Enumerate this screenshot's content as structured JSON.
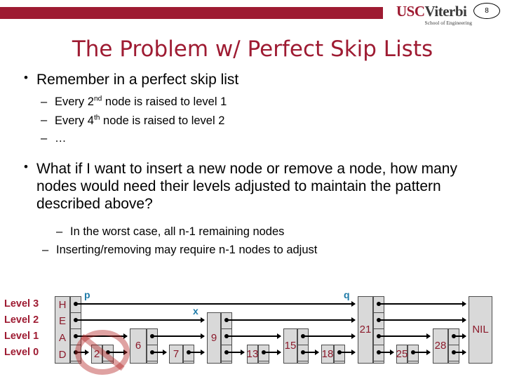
{
  "header": {
    "logo_main_usc": "USC",
    "logo_main_viterbi": "Viterbi",
    "logo_sub": "School of Engineering",
    "slide_number": "8",
    "bar_color": "#9e1b32"
  },
  "title": "The Problem w/ Perfect Skip Lists",
  "content": {
    "bullet1": {
      "marker": "•",
      "text": "Remember in a perfect skip list",
      "subs": [
        {
          "marker": "–",
          "pre": "Every 2",
          "sup": "nd",
          "post": " node is raised to level 1"
        },
        {
          "marker": "–",
          "pre": "Every 4",
          "sup": "th",
          "post": " node is raised to level 2"
        },
        {
          "marker": "–",
          "pre": "…",
          "sup": "",
          "post": ""
        }
      ]
    },
    "bullet2": {
      "marker": "•",
      "text": "What if I want to insert a new node or remove a node, how many nodes would need their levels adjusted to maintain the pattern described above?",
      "subs": [
        {
          "marker": "–",
          "text": "In the worst case, all n-1 remaining nodes"
        },
        {
          "marker": "–",
          "text": "Inserting/removing may require n-1 nodes to adjust"
        }
      ]
    }
  },
  "diagram": {
    "level_labels": [
      "Level 3",
      "Level 2",
      "Level 1",
      "Level 0"
    ],
    "head_label": "HEAD",
    "nil_label": "NIL",
    "nodes": [
      {
        "value": "2",
        "max_level": 0,
        "struck_out": true
      },
      {
        "value": "6",
        "max_level": 1,
        "struck_out": false
      },
      {
        "value": "7",
        "max_level": 0,
        "struck_out": false
      },
      {
        "value": "9",
        "max_level": 2,
        "struck_out": false
      },
      {
        "value": "13",
        "max_level": 0,
        "struck_out": false
      },
      {
        "value": "15",
        "max_level": 1,
        "struck_out": false
      },
      {
        "value": "18",
        "max_level": 0,
        "struck_out": false
      },
      {
        "value": "21",
        "max_level": 3,
        "struck_out": false
      },
      {
        "value": "25",
        "max_level": 0,
        "struck_out": false
      },
      {
        "value": "28",
        "max_level": 1,
        "struck_out": false
      }
    ],
    "pointer_labels": [
      {
        "name": "p",
        "target": "head-level3"
      },
      {
        "name": "x",
        "target": "node-9"
      },
      {
        "name": "q",
        "target": "node-21"
      }
    ],
    "colors": {
      "node_fill": "#d9d9d9",
      "node_border": "#4d4d4d",
      "value_text": "#8b1a2b",
      "level_label": "#9e1b32",
      "pointer_label": "#1f7ba8",
      "no_entry": "#b22222"
    }
  }
}
